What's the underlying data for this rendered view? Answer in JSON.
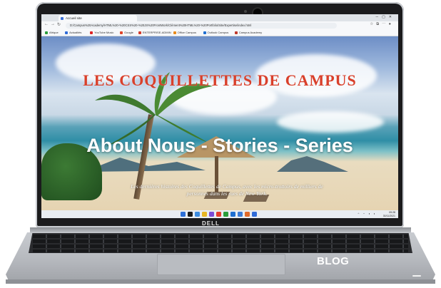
{
  "browser": {
    "tab_title": "Accueil site",
    "url": "D:/Campus%20Academy/HTML%20-%20CSS%20-%20JS%20FrontWork/Clément%20HTML%20-%20Portfolio/Site/Expertise/index.html",
    "bookmarks": [
      {
        "label": "Afrique",
        "color": "#2a9d3a"
      },
      {
        "label": "Actualités",
        "color": "#2f6bd8"
      },
      {
        "label": "YouTube Music",
        "color": "#e02424"
      },
      {
        "label": "Google",
        "color": "#e0442a"
      },
      {
        "label": "ENTERPRISE-ADMIN",
        "color": "#d43b2a"
      },
      {
        "label": "Office Campus",
        "color": "#e88a1a"
      },
      {
        "label": "Outlook Campus",
        "color": "#1f6fd1"
      },
      {
        "label": "Campus Academy",
        "color": "#c0392b"
      }
    ]
  },
  "page": {
    "site_title": "LES COQUILLETTES DE CAMPUS",
    "headline": "About Nous - Stories - Series",
    "tagline": "Les dernières histoires des Coquillettes de Campus, avec les micro-trottoirs de milliers de personnes dans les rues de New York."
  },
  "taskbar": {
    "clock_time": "09:28",
    "clock_date": "30/11/2021",
    "icon_colors": [
      "#2d6fd6",
      "#1a1a1a",
      "#3c8ce0",
      "#e8b623",
      "#7a4bd6",
      "#e43c2d",
      "#2a9d3a",
      "#1f6fd1",
      "#3b7bd6",
      "#e06a2a",
      "#2f6bd8"
    ]
  },
  "laptop": {
    "brand": "DELL"
  },
  "overlay": {
    "label": "BLOG"
  }
}
